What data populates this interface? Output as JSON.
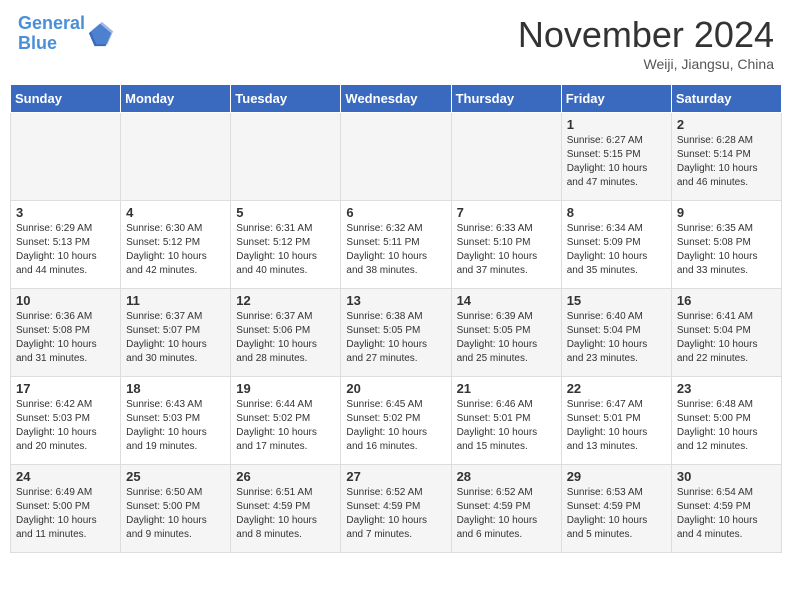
{
  "header": {
    "logo_line1": "General",
    "logo_line2": "Blue",
    "month_title": "November 2024",
    "location": "Weiji, Jiangsu, China"
  },
  "days_of_week": [
    "Sunday",
    "Monday",
    "Tuesday",
    "Wednesday",
    "Thursday",
    "Friday",
    "Saturday"
  ],
  "weeks": [
    [
      {
        "day": "",
        "info": ""
      },
      {
        "day": "",
        "info": ""
      },
      {
        "day": "",
        "info": ""
      },
      {
        "day": "",
        "info": ""
      },
      {
        "day": "",
        "info": ""
      },
      {
        "day": "1",
        "info": "Sunrise: 6:27 AM\nSunset: 5:15 PM\nDaylight: 10 hours and 47 minutes."
      },
      {
        "day": "2",
        "info": "Sunrise: 6:28 AM\nSunset: 5:14 PM\nDaylight: 10 hours and 46 minutes."
      }
    ],
    [
      {
        "day": "3",
        "info": "Sunrise: 6:29 AM\nSunset: 5:13 PM\nDaylight: 10 hours and 44 minutes."
      },
      {
        "day": "4",
        "info": "Sunrise: 6:30 AM\nSunset: 5:12 PM\nDaylight: 10 hours and 42 minutes."
      },
      {
        "day": "5",
        "info": "Sunrise: 6:31 AM\nSunset: 5:12 PM\nDaylight: 10 hours and 40 minutes."
      },
      {
        "day": "6",
        "info": "Sunrise: 6:32 AM\nSunset: 5:11 PM\nDaylight: 10 hours and 38 minutes."
      },
      {
        "day": "7",
        "info": "Sunrise: 6:33 AM\nSunset: 5:10 PM\nDaylight: 10 hours and 37 minutes."
      },
      {
        "day": "8",
        "info": "Sunrise: 6:34 AM\nSunset: 5:09 PM\nDaylight: 10 hours and 35 minutes."
      },
      {
        "day": "9",
        "info": "Sunrise: 6:35 AM\nSunset: 5:08 PM\nDaylight: 10 hours and 33 minutes."
      }
    ],
    [
      {
        "day": "10",
        "info": "Sunrise: 6:36 AM\nSunset: 5:08 PM\nDaylight: 10 hours and 31 minutes."
      },
      {
        "day": "11",
        "info": "Sunrise: 6:37 AM\nSunset: 5:07 PM\nDaylight: 10 hours and 30 minutes."
      },
      {
        "day": "12",
        "info": "Sunrise: 6:37 AM\nSunset: 5:06 PM\nDaylight: 10 hours and 28 minutes."
      },
      {
        "day": "13",
        "info": "Sunrise: 6:38 AM\nSunset: 5:05 PM\nDaylight: 10 hours and 27 minutes."
      },
      {
        "day": "14",
        "info": "Sunrise: 6:39 AM\nSunset: 5:05 PM\nDaylight: 10 hours and 25 minutes."
      },
      {
        "day": "15",
        "info": "Sunrise: 6:40 AM\nSunset: 5:04 PM\nDaylight: 10 hours and 23 minutes."
      },
      {
        "day": "16",
        "info": "Sunrise: 6:41 AM\nSunset: 5:04 PM\nDaylight: 10 hours and 22 minutes."
      }
    ],
    [
      {
        "day": "17",
        "info": "Sunrise: 6:42 AM\nSunset: 5:03 PM\nDaylight: 10 hours and 20 minutes."
      },
      {
        "day": "18",
        "info": "Sunrise: 6:43 AM\nSunset: 5:03 PM\nDaylight: 10 hours and 19 minutes."
      },
      {
        "day": "19",
        "info": "Sunrise: 6:44 AM\nSunset: 5:02 PM\nDaylight: 10 hours and 17 minutes."
      },
      {
        "day": "20",
        "info": "Sunrise: 6:45 AM\nSunset: 5:02 PM\nDaylight: 10 hours and 16 minutes."
      },
      {
        "day": "21",
        "info": "Sunrise: 6:46 AM\nSunset: 5:01 PM\nDaylight: 10 hours and 15 minutes."
      },
      {
        "day": "22",
        "info": "Sunrise: 6:47 AM\nSunset: 5:01 PM\nDaylight: 10 hours and 13 minutes."
      },
      {
        "day": "23",
        "info": "Sunrise: 6:48 AM\nSunset: 5:00 PM\nDaylight: 10 hours and 12 minutes."
      }
    ],
    [
      {
        "day": "24",
        "info": "Sunrise: 6:49 AM\nSunset: 5:00 PM\nDaylight: 10 hours and 11 minutes."
      },
      {
        "day": "25",
        "info": "Sunrise: 6:50 AM\nSunset: 5:00 PM\nDaylight: 10 hours and 9 minutes."
      },
      {
        "day": "26",
        "info": "Sunrise: 6:51 AM\nSunset: 4:59 PM\nDaylight: 10 hours and 8 minutes."
      },
      {
        "day": "27",
        "info": "Sunrise: 6:52 AM\nSunset: 4:59 PM\nDaylight: 10 hours and 7 minutes."
      },
      {
        "day": "28",
        "info": "Sunrise: 6:52 AM\nSunset: 4:59 PM\nDaylight: 10 hours and 6 minutes."
      },
      {
        "day": "29",
        "info": "Sunrise: 6:53 AM\nSunset: 4:59 PM\nDaylight: 10 hours and 5 minutes."
      },
      {
        "day": "30",
        "info": "Sunrise: 6:54 AM\nSunset: 4:59 PM\nDaylight: 10 hours and 4 minutes."
      }
    ]
  ]
}
